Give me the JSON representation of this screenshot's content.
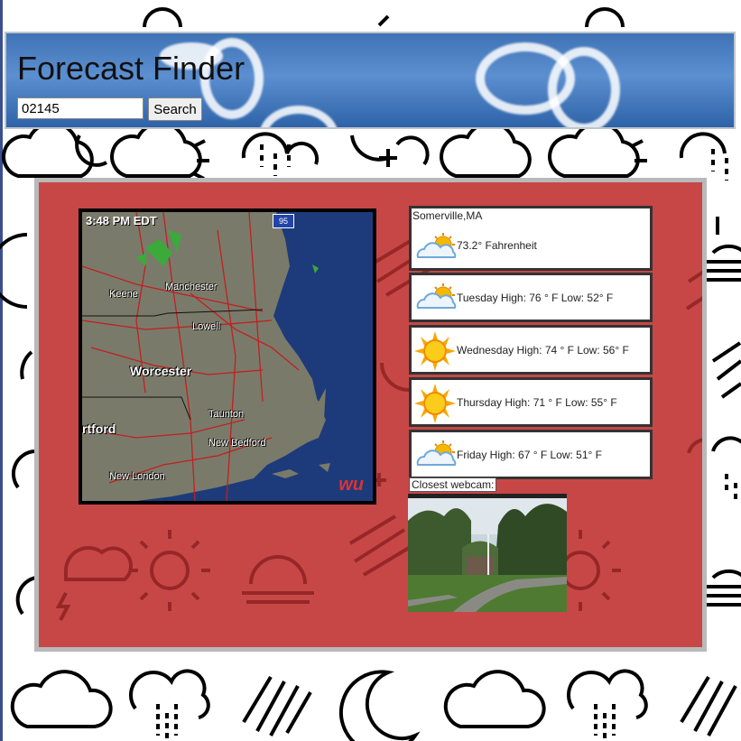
{
  "header": {
    "title": "Forecast Finder",
    "zip_value": "02145",
    "search_label": "Search"
  },
  "radar": {
    "timestamp": "3:48 PM EDT",
    "interstate": "95",
    "cities": [
      "Keene",
      "Manchester",
      "Lowell",
      "Worcester",
      "Taunton",
      "New Bedford",
      "rtford",
      "New London"
    ],
    "logo": "wu"
  },
  "current": {
    "location": "Somerville,MA",
    "temperature": "73.2° Fahrenheit",
    "icon": "partly-cloudy-icon"
  },
  "forecast": [
    {
      "text": "Tuesday High: 76 ° F Low: 52° F",
      "icon": "partly-cloudy-icon"
    },
    {
      "text": "Wednesday High: 74 ° F Low: 56° F",
      "icon": "sunny-icon"
    },
    {
      "text": "Thursday High: 71 ° F Low: 55° F",
      "icon": "sunny-icon"
    },
    {
      "text": "Friday High: 67 ° F Low: 51° F",
      "icon": "partly-cloudy-icon"
    }
  ],
  "webcam": {
    "label": "Closest webcam:"
  },
  "colors": {
    "panel": "#c74747",
    "header": "#3f73b5",
    "panel_border": "#b9b9b9"
  }
}
